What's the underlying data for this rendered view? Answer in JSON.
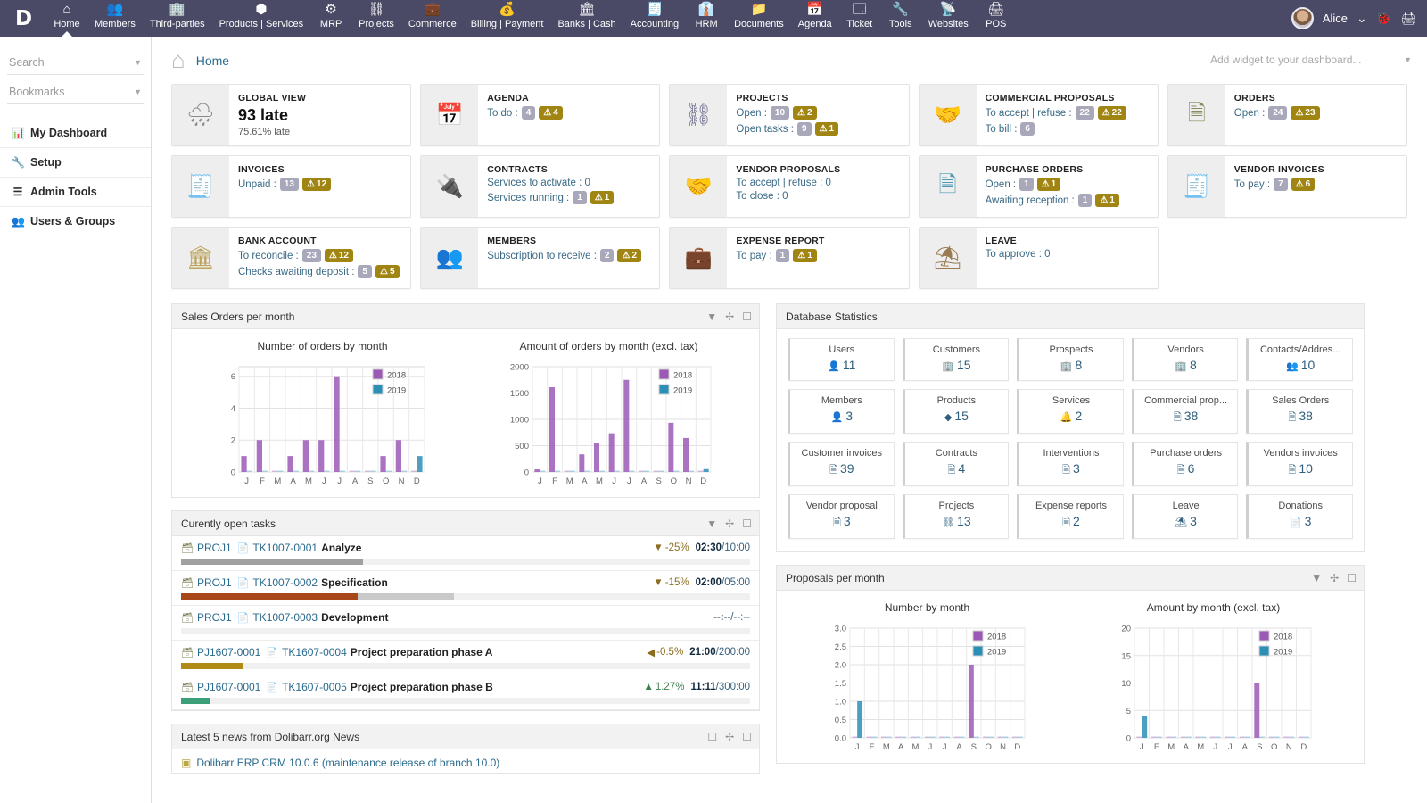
{
  "topnav": {
    "brand": "D",
    "items": [
      {
        "label": "Home",
        "icon": "home-icon",
        "glyph": "⌂",
        "active": true
      },
      {
        "label": "Members",
        "icon": "members-icon",
        "glyph": "👥",
        "active": false
      },
      {
        "label": "Third-parties",
        "icon": "thirdparties-icon",
        "glyph": "🏢",
        "active": false
      },
      {
        "label": "Products | Services",
        "icon": "products-icon",
        "glyph": "⬢",
        "active": false
      },
      {
        "label": "MRP",
        "icon": "mrp-icon",
        "glyph": "⚙",
        "active": false
      },
      {
        "label": "Projects",
        "icon": "projects-icon",
        "glyph": "⛓",
        "active": false
      },
      {
        "label": "Commerce",
        "icon": "commerce-icon",
        "glyph": "💼",
        "active": false
      },
      {
        "label": "Billing | Payment",
        "icon": "billing-icon",
        "glyph": "💰",
        "active": false
      },
      {
        "label": "Banks | Cash",
        "icon": "bank-icon",
        "glyph": "🏛",
        "active": false
      },
      {
        "label": "Accounting",
        "icon": "accounting-icon",
        "glyph": "🧾",
        "active": false
      },
      {
        "label": "HRM",
        "icon": "hrm-icon",
        "glyph": "👔",
        "active": false
      },
      {
        "label": "Documents",
        "icon": "documents-icon",
        "glyph": "📁",
        "active": false
      },
      {
        "label": "Agenda",
        "icon": "agenda-icon",
        "glyph": "📅",
        "active": false
      },
      {
        "label": "Ticket",
        "icon": "ticket-icon",
        "glyph": "🗔",
        "active": false
      },
      {
        "label": "Tools",
        "icon": "tools-icon",
        "glyph": "🔧",
        "active": false
      },
      {
        "label": "Websites",
        "icon": "websites-icon",
        "glyph": "📡",
        "active": false
      },
      {
        "label": "POS",
        "icon": "pos-icon",
        "glyph": "🖨",
        "active": false
      }
    ],
    "user": "Alice",
    "user_caret": "⌄",
    "bug_icon": "🐞",
    "print_icon": "🖨"
  },
  "sidebar": {
    "search_placeholder": "Search",
    "bookmarks_placeholder": "Bookmarks",
    "items": [
      {
        "label": "My Dashboard",
        "icon": "chart-icon",
        "glyph": "📊"
      },
      {
        "label": "Setup",
        "icon": "wrench-icon",
        "glyph": "🔧"
      },
      {
        "label": "Admin Tools",
        "icon": "list-icon",
        "glyph": "☰"
      },
      {
        "label": "Users & Groups",
        "icon": "users-icon",
        "glyph": "👥"
      }
    ]
  },
  "header": {
    "home_icon": "home-icon",
    "title": "Home",
    "add_widget_placeholder": "Add widget to your dashboard..."
  },
  "cards": [
    {
      "title": "GLOBAL VIEW",
      "icon": "rain-cloud-icon",
      "glyph": "🌧",
      "icon_color": "#8a8a8a",
      "big": "93 late",
      "sub": "75.61% late",
      "lines": []
    },
    {
      "title": "AGENDA",
      "icon": "calendar-icon",
      "glyph": "📅",
      "icon_color": "#c2728c",
      "lines": [
        {
          "label": "To do :",
          "grey": "4",
          "warn": "4"
        }
      ]
    },
    {
      "title": "PROJECTS",
      "icon": "project-tree-icon",
      "glyph": "⛓",
      "icon_color": "#6e6e8e",
      "lines": [
        {
          "label": "Open :",
          "grey": "10",
          "warn": "2"
        },
        {
          "label": "Open tasks :",
          "grey": "9",
          "warn": "1"
        }
      ]
    },
    {
      "title": "COMMERCIAL PROPOSALS",
      "icon": "handshake-icon",
      "glyph": "🤝",
      "icon_color": "#9a9a7a",
      "lines": [
        {
          "label": "To accept | refuse :",
          "grey": "22",
          "warn": "22"
        },
        {
          "label": "To bill :",
          "grey": "6",
          "warn": ""
        }
      ]
    },
    {
      "title": "ORDERS",
      "icon": "order-doc-icon",
      "glyph": "🗎",
      "icon_color": "#8a8a60",
      "lines": [
        {
          "label": "Open :",
          "grey": "24",
          "warn": "23"
        }
      ]
    },
    {
      "title": "INVOICES",
      "icon": "invoice-icon",
      "glyph": "🧾",
      "icon_color": "#8f8f6a",
      "lines": [
        {
          "label": "Unpaid :",
          "grey": "13",
          "warn": "12"
        }
      ]
    },
    {
      "title": "CONTRACTS",
      "icon": "plug-icon",
      "glyph": "🔌",
      "icon_color": "#3f9e8e",
      "lines": [
        {
          "label": "Services to activate : 0",
          "grey": "",
          "warn": ""
        },
        {
          "label": "Services running :",
          "grey": "1",
          "warn": "1"
        }
      ]
    },
    {
      "title": "VENDOR PROPOSALS",
      "icon": "handshake-icon",
      "glyph": "🤝",
      "icon_color": "#3f9e9e",
      "lines": [
        {
          "label": "To accept | refuse : 0",
          "grey": "",
          "warn": ""
        },
        {
          "label": "To close : 0",
          "grey": "",
          "warn": ""
        }
      ]
    },
    {
      "title": "PURCHASE ORDERS",
      "icon": "order-doc-icon",
      "glyph": "🗎",
      "icon_color": "#4f9ab5",
      "lines": [
        {
          "label": "Open :",
          "grey": "1",
          "warn": "1"
        },
        {
          "label": "Awaiting reception :",
          "grey": "1",
          "warn": "1"
        }
      ]
    },
    {
      "title": "VENDOR INVOICES",
      "icon": "invoice-icon",
      "glyph": "🧾",
      "icon_color": "#4f9ab5",
      "lines": [
        {
          "label": "To pay :",
          "grey": "7",
          "warn": "6"
        }
      ]
    },
    {
      "title": "BANK ACCOUNT",
      "icon": "bank-icon",
      "glyph": "🏛",
      "icon_color": "#bda45c",
      "lines": [
        {
          "label": "To reconcile :",
          "grey": "23",
          "warn": "12"
        },
        {
          "label": "Checks awaiting deposit :",
          "grey": "5",
          "warn": "5"
        }
      ]
    },
    {
      "title": "MEMBERS",
      "icon": "members-icon",
      "glyph": "👥",
      "icon_color": "#7c7c7c",
      "lines": [
        {
          "label": "Subscription to receive :",
          "grey": "2",
          "warn": "2"
        }
      ]
    },
    {
      "title": "EXPENSE REPORT",
      "icon": "wallet-icon",
      "glyph": "💼",
      "icon_color": "#8a6a4a",
      "lines": [
        {
          "label": "To pay :",
          "grey": "1",
          "warn": "1"
        }
      ]
    },
    {
      "title": "LEAVE",
      "icon": "beach-umbrella-icon",
      "glyph": "⛱",
      "icon_color": "#9a7a50",
      "lines": [
        {
          "label": "To approve : 0",
          "grey": "",
          "warn": ""
        }
      ]
    }
  ],
  "widgets": {
    "sales_orders_title": "Sales Orders per month",
    "open_tasks_title": "Curently open tasks",
    "news_title": "Latest 5 news from Dolibarr.org News",
    "db_stats_title": "Database Statistics",
    "proposals_title": "Proposals per month",
    "tool_filter": "filter-icon",
    "tool_move": "move-icon",
    "tool_close": "close-icon",
    "tool_help": "help-icon"
  },
  "tasks": [
    {
      "project": "PROJ1",
      "ref": "TK1007-0001",
      "name": "Analyze",
      "pct": "-25%",
      "trend": "down",
      "time": "02:30",
      "budget": "10:00",
      "progress": 32,
      "bar_color": "#a0a0a0",
      "bar2": 0
    },
    {
      "project": "PROJ1",
      "ref": "TK1007-0002",
      "name": "Specification",
      "pct": "-15%",
      "trend": "down",
      "time": "02:00",
      "budget": "05:00",
      "progress": 31,
      "bar_color": "#a8471a",
      "bar2": 48
    },
    {
      "project": "PROJ1",
      "ref": "TK1007-0003",
      "name": "Development",
      "pct": "",
      "trend": "none",
      "time": "--:--",
      "budget": "--:--",
      "progress": 0,
      "bar_color": "#a0a0a0",
      "bar2": 0
    },
    {
      "project": "PJ1607-0001",
      "ref": "TK1607-0004",
      "name": "Project preparation phase A",
      "pct": "-0.5%",
      "trend": "flat",
      "time": "21:00",
      "budget": "200:00",
      "progress": 11,
      "bar_color": "#b08b15",
      "bar2": 0
    },
    {
      "project": "PJ1607-0001",
      "ref": "TK1607-0005",
      "name": "Project preparation phase B",
      "pct": "1.27%",
      "trend": "up",
      "time": "11:11",
      "budget": "300:00",
      "progress": 5,
      "bar_color": "#3d9e7a",
      "bar2": 0
    }
  ],
  "db_stats": [
    {
      "label": "Users",
      "value": "11",
      "glyph": "👤"
    },
    {
      "label": "Customers",
      "value": "15",
      "glyph": "🏢"
    },
    {
      "label": "Prospects",
      "value": "8",
      "glyph": "🏢"
    },
    {
      "label": "Vendors",
      "value": "8",
      "glyph": "🏢"
    },
    {
      "label": "Contacts/Addres...",
      "value": "10",
      "glyph": "👥"
    },
    {
      "label": "Members",
      "value": "3",
      "glyph": "👤"
    },
    {
      "label": "Products",
      "value": "15",
      "glyph": "◆"
    },
    {
      "label": "Services",
      "value": "2",
      "glyph": "🔔"
    },
    {
      "label": "Commercial prop...",
      "value": "38",
      "glyph": "🗎"
    },
    {
      "label": "Sales Orders",
      "value": "38",
      "glyph": "🗎"
    },
    {
      "label": "Customer invoices",
      "value": "39",
      "glyph": "🗎"
    },
    {
      "label": "Contracts",
      "value": "4",
      "glyph": "🗎"
    },
    {
      "label": "Interventions",
      "value": "3",
      "glyph": "🗎"
    },
    {
      "label": "Purchase orders",
      "value": "6",
      "glyph": "🗎"
    },
    {
      "label": "Vendors invoices",
      "value": "10",
      "glyph": "🗎"
    },
    {
      "label": "Vendor proposal",
      "value": "3",
      "glyph": "🗎"
    },
    {
      "label": "Projects",
      "value": "13",
      "glyph": "⛓"
    },
    {
      "label": "Expense reports",
      "value": "2",
      "glyph": "🗎"
    },
    {
      "label": "Leave",
      "value": "3",
      "glyph": "⛱"
    },
    {
      "label": "Donations",
      "value": "3",
      "glyph": "📄"
    }
  ],
  "news": [
    {
      "text": "Dolibarr ERP CRM 10.0.6 (maintenance release of branch 10.0)"
    }
  ],
  "chart_data": [
    {
      "type": "bar",
      "title": "Number of orders by month",
      "widget": "Sales Orders per month",
      "categories": [
        "J",
        "F",
        "M",
        "A",
        "M",
        "J",
        "J",
        "A",
        "S",
        "O",
        "N",
        "D"
      ],
      "series": [
        {
          "name": "2018",
          "color": "#9b59b6",
          "values": [
            1,
            2,
            0,
            1,
            2,
            2,
            6,
            0,
            0,
            1,
            2,
            0
          ]
        },
        {
          "name": "2019",
          "color": "#2c8fb5",
          "values": [
            0,
            0,
            0,
            0,
            0,
            0,
            0,
            0,
            0,
            0,
            0,
            1
          ]
        }
      ],
      "ylim": [
        0,
        6.6
      ],
      "yticks": [
        0,
        2,
        4,
        6
      ],
      "grid": true,
      "legend_position": "top-right",
      "xlabel": "",
      "ylabel": ""
    },
    {
      "type": "bar",
      "title": "Amount of orders by month (excl. tax)",
      "widget": "Sales Orders per month",
      "categories": [
        "J",
        "F",
        "M",
        "A",
        "M",
        "J",
        "J",
        "A",
        "S",
        "O",
        "N",
        "D"
      ],
      "series": [
        {
          "name": "2018",
          "color": "#9b59b6",
          "values": [
            50,
            1610,
            0,
            335,
            555,
            735,
            1750,
            0,
            0,
            935,
            645,
            0
          ]
        },
        {
          "name": "2019",
          "color": "#2c8fb5",
          "values": [
            0,
            0,
            0,
            0,
            0,
            0,
            0,
            0,
            0,
            0,
            0,
            55
          ]
        }
      ],
      "ylim": [
        0,
        2000
      ],
      "yticks": [
        0,
        500,
        1000,
        1500,
        2000
      ],
      "grid": true,
      "legend_position": "top-right",
      "xlabel": "",
      "ylabel": ""
    },
    {
      "type": "bar",
      "title": "Number by month",
      "widget": "Proposals per month",
      "categories": [
        "J",
        "F",
        "M",
        "A",
        "M",
        "J",
        "J",
        "A",
        "S",
        "O",
        "N",
        "D"
      ],
      "series": [
        {
          "name": "2018",
          "color": "#9b59b6",
          "values": [
            0,
            0,
            0,
            0,
            0,
            0,
            0,
            0,
            2,
            0,
            0,
            0
          ]
        },
        {
          "name": "2019",
          "color": "#2c8fb5",
          "values": [
            1,
            0,
            0,
            0,
            0,
            0,
            0,
            0,
            0,
            0,
            0,
            0
          ]
        }
      ],
      "ylim": [
        0,
        3.0
      ],
      "yticks": [
        0.0,
        0.5,
        1.0,
        1.5,
        2.0,
        2.5,
        3.0
      ],
      "grid": true,
      "legend_position": "top-right",
      "xlabel": "",
      "ylabel": ""
    },
    {
      "type": "bar",
      "title": "Amount by month (excl. tax)",
      "widget": "Proposals per month",
      "categories": [
        "J",
        "F",
        "M",
        "A",
        "M",
        "J",
        "J",
        "A",
        "S",
        "O",
        "N",
        "D"
      ],
      "series": [
        {
          "name": "2018",
          "color": "#9b59b6",
          "values": [
            0,
            0,
            0,
            0,
            0,
            0,
            0,
            0,
            10,
            0,
            0,
            0
          ]
        },
        {
          "name": "2019",
          "color": "#2c8fb5",
          "values": [
            4,
            0,
            0,
            0,
            0,
            0,
            0,
            0,
            0,
            0,
            0,
            0
          ]
        }
      ],
      "ylim": [
        0,
        20
      ],
      "yticks": [
        0,
        5,
        10,
        15,
        20
      ],
      "grid": true,
      "legend_position": "top-right",
      "xlabel": "",
      "ylabel": ""
    }
  ],
  "colors": {
    "navbar": "#4b4a66",
    "accent_link": "#2a6a8d",
    "badge_grey": "#a9a8bb",
    "badge_warn": "#a08512",
    "series_2018": "#9b59b6",
    "series_2019": "#2c8fb5"
  }
}
